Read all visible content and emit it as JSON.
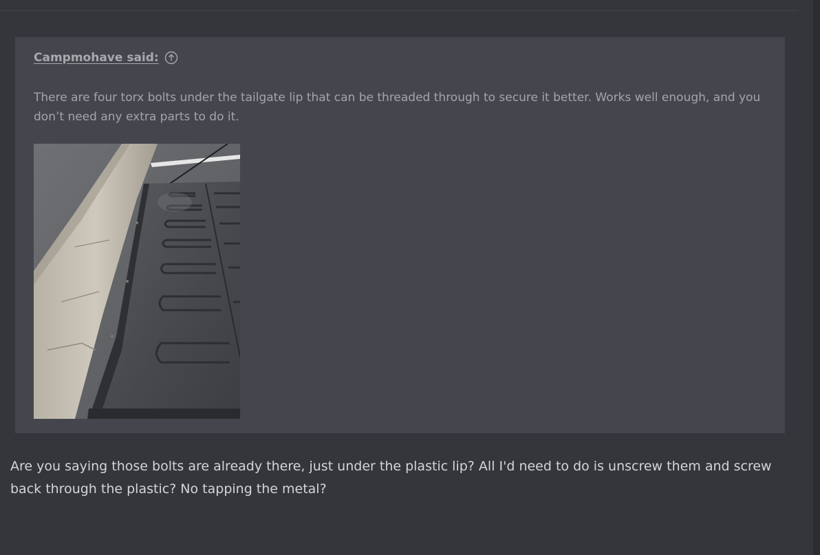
{
  "quote": {
    "author_label": "Campmohave said:",
    "icon": "arrow-up-circle-icon",
    "text": "There are four torx bolts under the tailgate lip that can be threaded through to secure it better. Works well enough, and you don’t need any extra parts to do it."
  },
  "reply": {
    "text": "Are you saying those bolts are already there, just under the plastic lip? All I'd need to do is unscrew them and screw back through the plastic? No tapping the metal?"
  },
  "colors": {
    "background": "#34363c",
    "quote_background": "#45464d",
    "reply_text": "#d4d5d8",
    "quote_text": "#a4a5a9"
  }
}
